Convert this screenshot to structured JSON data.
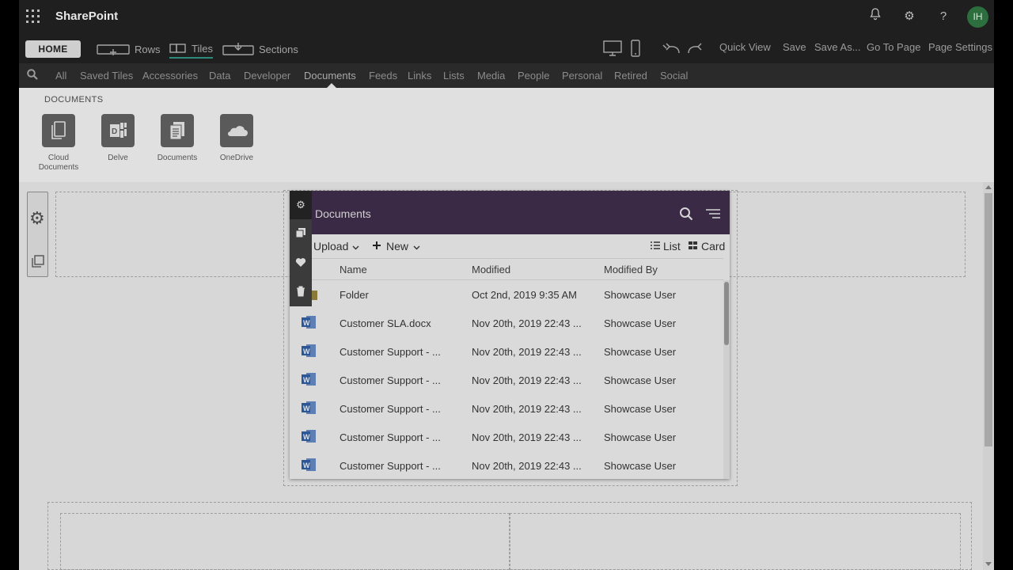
{
  "app": {
    "brand": "SharePoint",
    "avatar_initials": "IH"
  },
  "toolbar": {
    "home_label": "HOME",
    "rows_label": "Rows",
    "tiles_label": "Tiles",
    "sections_label": "Sections",
    "quick_view_label": "Quick View",
    "save_label": "Save",
    "save_as_label": "Save As...",
    "go_to_page_label": "Go To Page",
    "page_settings_label": "Page Settings"
  },
  "categories": {
    "items": [
      "All",
      "Saved Tiles",
      "Accessories",
      "Data",
      "Developer",
      "Documents",
      "Feeds",
      "Links",
      "Lists",
      "Media",
      "People",
      "Personal",
      "Retired",
      "Social"
    ],
    "selected": "Documents"
  },
  "gallery": {
    "title": "DOCUMENTS",
    "tiles": [
      {
        "label": "Cloud Documents",
        "icon": "cloud-documents-icon"
      },
      {
        "label": "Delve",
        "icon": "delve-icon"
      },
      {
        "label": "Documents",
        "icon": "documents-icon"
      },
      {
        "label": "OneDrive",
        "icon": "onedrive-icon"
      }
    ]
  },
  "webpart": {
    "title": "Documents",
    "upload_label": "Upload",
    "new_label": "New",
    "list_label": "List",
    "card_label": "Card",
    "columns": {
      "name": "Name",
      "modified": "Modified",
      "modified_by": "Modified By"
    },
    "rows": [
      {
        "type": "folder",
        "name": "Folder",
        "modified": "Oct 2nd, 2019 9:35 AM",
        "modified_by": "Showcase User"
      },
      {
        "type": "word",
        "name": "Customer SLA.docx",
        "modified": "Nov 20th, 2019 22:43 ...",
        "modified_by": "Showcase User"
      },
      {
        "type": "word",
        "name": "Customer Support - ...",
        "modified": "Nov 20th, 2019 22:43 ...",
        "modified_by": "Showcase User"
      },
      {
        "type": "word",
        "name": "Customer Support - ...",
        "modified": "Nov 20th, 2019 22:43 ...",
        "modified_by": "Showcase User"
      },
      {
        "type": "word",
        "name": "Customer Support - ...",
        "modified": "Nov 20th, 2019 22:43 ...",
        "modified_by": "Showcase User"
      },
      {
        "type": "word",
        "name": "Customer Support - ...",
        "modified": "Nov 20th, 2019 22:43 ...",
        "modified_by": "Showcase User"
      },
      {
        "type": "word",
        "name": "Customer Support - ...",
        "modified": "Nov 20th, 2019 22:43 ...",
        "modified_by": "Showcase User"
      }
    ]
  },
  "colors": {
    "accent_teal": "#2e8a7a",
    "header_purple": "#3a2a45",
    "word_blue": "#2b5797",
    "topbar": "#1f1f1f"
  }
}
